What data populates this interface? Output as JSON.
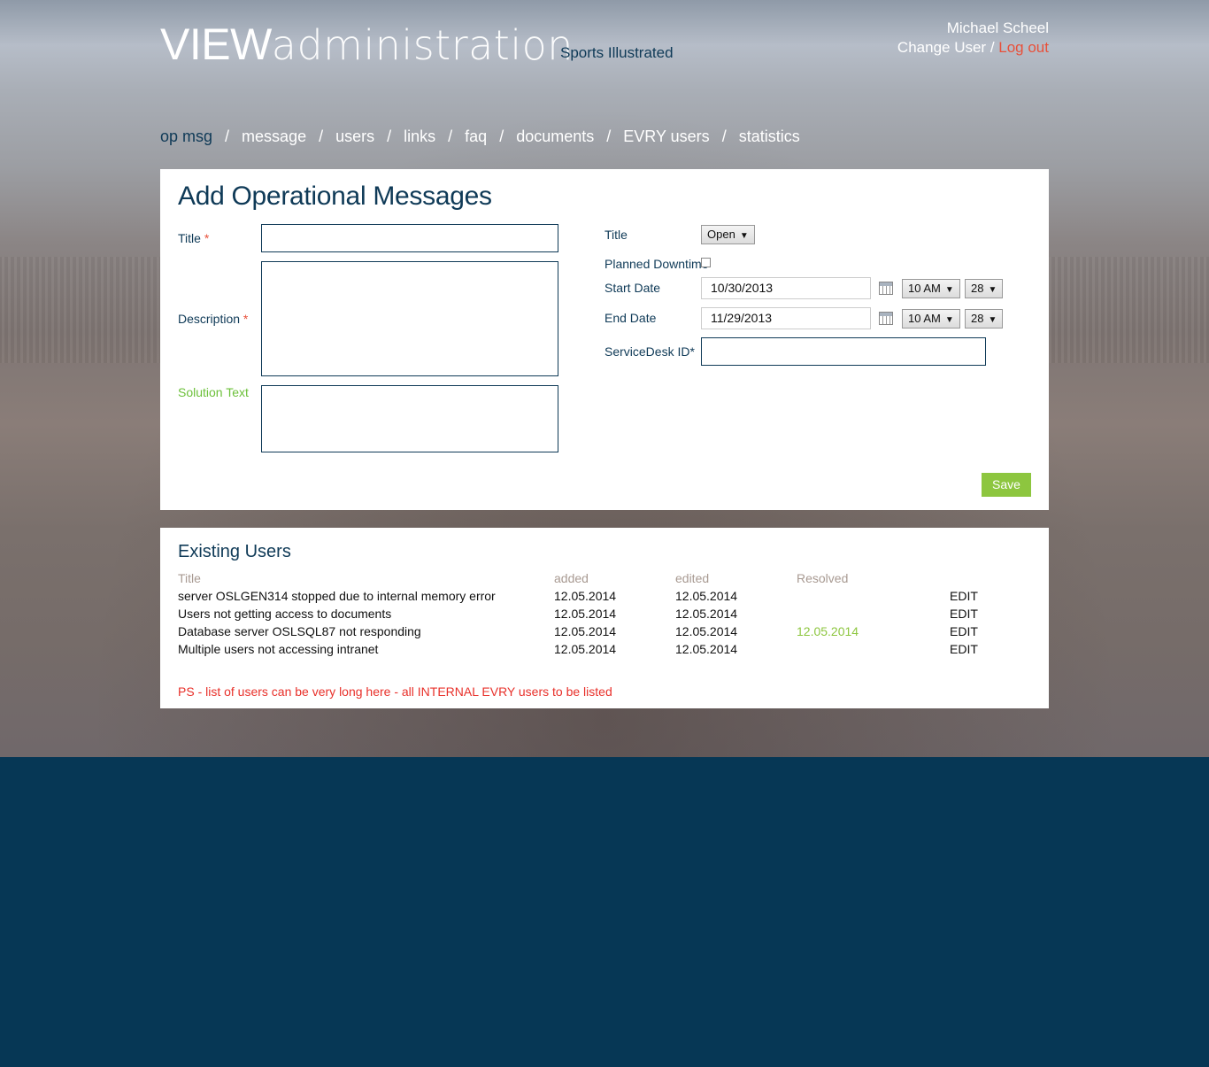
{
  "header": {
    "brand_bold": "VIEW",
    "brand_light": "administration",
    "org": "Sports Illustrated",
    "user_name": "Michael Scheel",
    "change_user": "Change User",
    "sep": " / ",
    "logout": "Log out"
  },
  "nav": {
    "items": [
      "op msg",
      "message",
      "users",
      "links",
      "faq",
      "documents",
      "EVRY users",
      "statistics"
    ],
    "sep": "/"
  },
  "form": {
    "heading": "Add Operational Messages",
    "title_label": "Title",
    "description_label": "Description",
    "solution_label": "Solution Text",
    "required_mark": "*",
    "title_value": "",
    "description_value": "",
    "solution_value": "",
    "right_title_label": "Title",
    "status_value": "Open",
    "planned_downtime_label": "Planned Downtime",
    "start_date_label": "Start Date",
    "start_date": "10/30/2013",
    "start_hour": "10 AM",
    "start_min": "28",
    "end_date_label": "End Date",
    "end_date": "11/29/2013",
    "end_hour": "10 AM",
    "end_min": "28",
    "servicedesk_label": "ServiceDesk ID*",
    "servicedesk_value": "",
    "save_label": "Save",
    "arrow": "▼"
  },
  "list": {
    "heading": "Existing Users",
    "columns": [
      "Title",
      "added",
      "edited",
      "Resolved"
    ],
    "rows": [
      {
        "title": "server OSLGEN314 stopped due to internal memory error",
        "added": "12.05.2014",
        "edited": "12.05.2014",
        "resolved": "",
        "action": "EDIT"
      },
      {
        "title": "Users not getting access to documents",
        "added": "12.05.2014",
        "edited": "12.05.2014",
        "resolved": "",
        "action": "EDIT"
      },
      {
        "title": "Database server OSLSQL87 not responding",
        "added": "12.05.2014",
        "edited": "12.05.2014",
        "resolved": "12.05.2014",
        "action": "EDIT"
      },
      {
        "title": "Multiple users not accessing intranet",
        "added": "12.05.2014",
        "edited": "12.05.2014",
        "resolved": "",
        "action": "EDIT"
      }
    ],
    "note": "PS - list of users can be very long here - all INTERNAL EVRY users to be listed"
  },
  "colors": {
    "brand_navy": "#0f3a57",
    "footer_bg": "#063755",
    "accent_green": "#8dc63f",
    "logout_red": "#e8503a"
  }
}
